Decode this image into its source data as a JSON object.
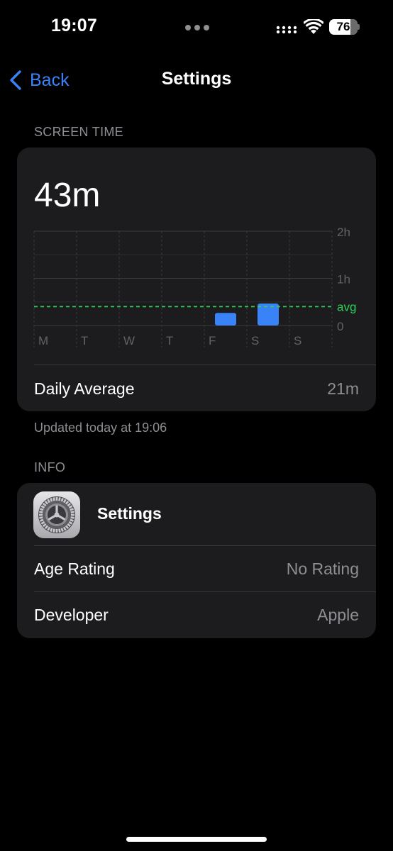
{
  "status_bar": {
    "time": "19:07",
    "battery_level": "76",
    "battery_fraction": 0.76
  },
  "nav": {
    "back_label": "Back",
    "title": "Settings"
  },
  "screen_time": {
    "section_header": "SCREEN TIME",
    "total": "43m",
    "daily_average_label": "Daily Average",
    "daily_average_value": "21m",
    "updated_text": "Updated today at 19:06"
  },
  "chart_data": {
    "type": "bar",
    "categories": [
      "M",
      "T",
      "W",
      "T",
      "F",
      "S",
      "S"
    ],
    "values": [
      0,
      0,
      0,
      0,
      16,
      28,
      0
    ],
    "value_unit": "minutes",
    "y_ticks": [
      "2h",
      "1h",
      "0"
    ],
    "ylim": [
      0,
      120
    ],
    "average_label": "avg",
    "average_value": 24,
    "bar_color": "#3a82f7",
    "average_color": "#30d158",
    "grid": true
  },
  "info": {
    "section_header": "INFO",
    "app_name": "Settings",
    "app_icon": "gear-icon",
    "rows": [
      {
        "label": "Age Rating",
        "value": "No Rating"
      },
      {
        "label": "Developer",
        "value": "Apple"
      }
    ]
  },
  "colors": {
    "accent": "#3a82f7",
    "card_background": "#1c1c1e",
    "secondary_text": "#8e8e93"
  }
}
